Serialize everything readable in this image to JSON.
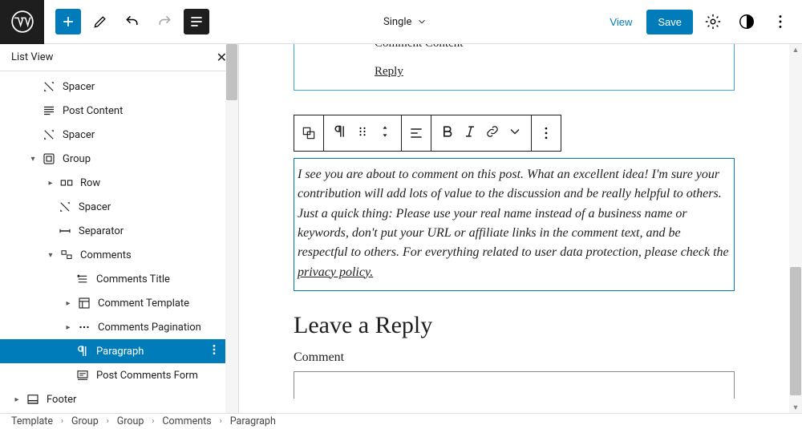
{
  "topbar": {
    "mode_label": "Single",
    "view_label": "View",
    "save_label": "Save"
  },
  "listview": {
    "title": "List View",
    "items": [
      {
        "key": "spacer1",
        "label": "Spacer",
        "indent": "ind1",
        "icon": "spacer-icon"
      },
      {
        "key": "postcontent",
        "label": "Post Content",
        "indent": "ind1",
        "icon": "postcontent-icon"
      },
      {
        "key": "spacer2",
        "label": "Spacer",
        "indent": "ind1",
        "icon": "spacer-icon"
      },
      {
        "key": "group",
        "label": "Group",
        "indent": "ind1c",
        "icon": "group-icon",
        "caret": "down"
      },
      {
        "key": "row",
        "label": "Row",
        "indent": "ind2c",
        "icon": "row-icon",
        "caret": "right"
      },
      {
        "key": "spacer3",
        "label": "Spacer",
        "indent": "ind2",
        "icon": "spacer-icon"
      },
      {
        "key": "separator",
        "label": "Separator",
        "indent": "ind2",
        "icon": "separator-icon"
      },
      {
        "key": "comments",
        "label": "Comments",
        "indent": "ind2c",
        "icon": "comments-icon",
        "caret": "down"
      },
      {
        "key": "ctitle",
        "label": "Comments Title",
        "indent": "ind3",
        "icon": "ctitle-icon"
      },
      {
        "key": "ctemplate",
        "label": "Comment Template",
        "indent": "ind3c",
        "icon": "ctemplate-icon",
        "caret": "right"
      },
      {
        "key": "cpag",
        "label": "Comments Pagination",
        "indent": "ind3c",
        "icon": "cpag-icon",
        "caret": "right"
      },
      {
        "key": "paragraph",
        "label": "Paragraph",
        "indent": "ind3",
        "icon": "paragraph-icon",
        "selected": true
      },
      {
        "key": "pcform",
        "label": "Post Comments Form",
        "indent": "ind3",
        "icon": "pcform-icon"
      },
      {
        "key": "footer",
        "label": "Footer",
        "indent": "ind0c",
        "icon": "footer-icon",
        "caret": "right"
      }
    ]
  },
  "canvas": {
    "comment_content_label": "Comment Content",
    "reply_label": "Reply",
    "paragraph_text": "I see you are about to comment on this post. What an excellent idea! I'm sure your contribution will add lots of value to the discussion and be really helpful to others. Just a quick thing: Please use your real name instead of a business name or keywords, don't put your URL or affiliate links in the comment text, and be respectful to others. For everything related to user data protection, please check the ",
    "paragraph_link": "privacy policy.",
    "leave_reply_heading": "Leave a Reply",
    "comment_field_label": "Comment"
  },
  "breadcrumbs": [
    "Template",
    "Group",
    "Group",
    "Comments",
    "Paragraph"
  ]
}
